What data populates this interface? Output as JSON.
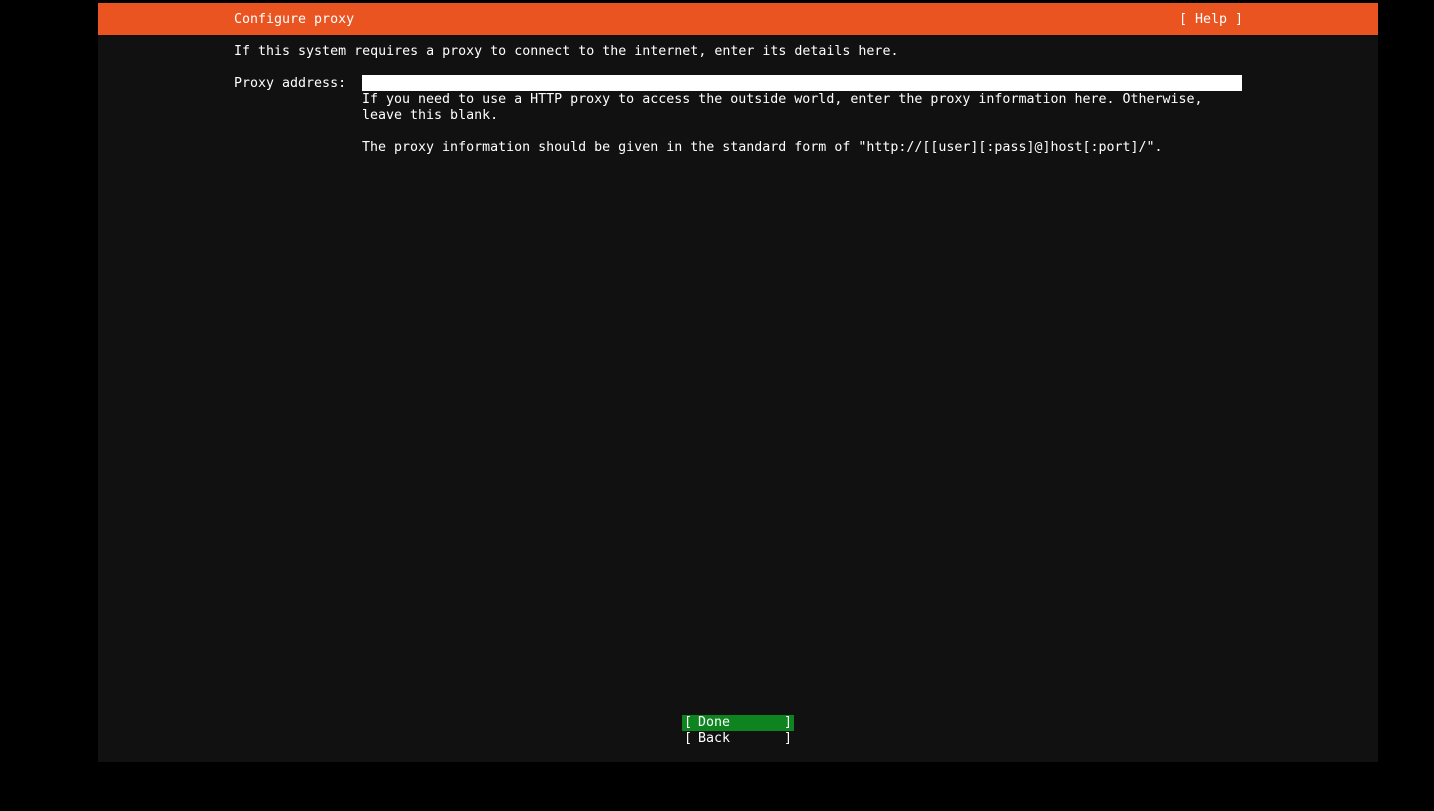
{
  "header": {
    "title": "Configure proxy",
    "help_label": "[ Help ]"
  },
  "intro": "If this system requires a proxy to connect to the internet, enter its details here.",
  "proxy": {
    "label": "Proxy address:",
    "value": "",
    "help_lines": [
      "If you need to use a HTTP proxy to access the outside world, enter the proxy information here. Otherwise,",
      "leave this blank.",
      "The proxy information should be given in the standard form of \"http://[[user][:pass]@]host[:port]/\"."
    ]
  },
  "buttons": {
    "done": "Done",
    "back": "Back",
    "bracket_open": "[",
    "bracket_close": "]"
  },
  "colors": {
    "header_bg": "#e95420",
    "panel_bg": "#111111",
    "selected_button_bg": "#0e8420",
    "input_bg": "#ffffff"
  }
}
